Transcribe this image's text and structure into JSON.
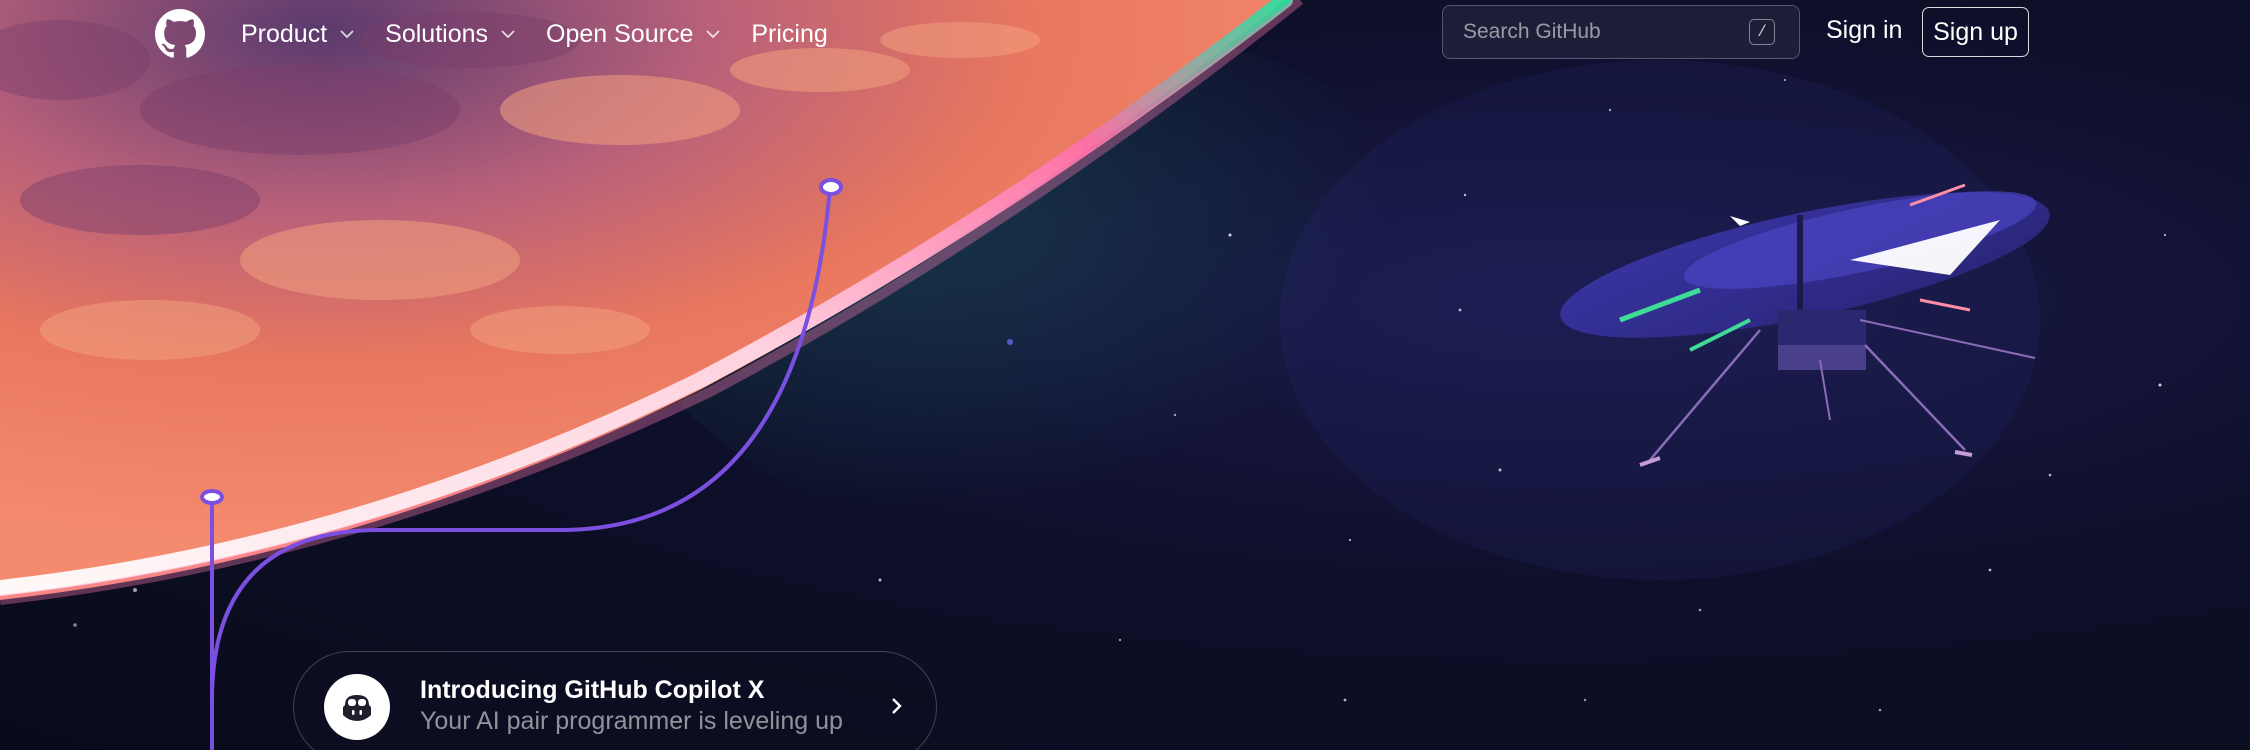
{
  "header": {
    "logo_icon": "github-octocat-icon",
    "nav": [
      {
        "label": "Product",
        "has_dropdown": true
      },
      {
        "label": "Solutions",
        "has_dropdown": true
      },
      {
        "label": "Open Source",
        "has_dropdown": true
      },
      {
        "label": "Pricing",
        "has_dropdown": false
      }
    ],
    "search": {
      "placeholder": "Search GitHub",
      "shortcut": "/"
    },
    "sign_in": "Sign in",
    "sign_up": "Sign up"
  },
  "promo": {
    "icon": "copilot-icon",
    "title": "Introducing GitHub Copilot X",
    "subtitle": "Your AI pair programmer is leveling up"
  },
  "colors": {
    "space": "#0e0f2a",
    "planet": "#e87a62",
    "atmosphere_glow": "#ff9ec0",
    "aurora": "#3ddc97",
    "line": "#7b4fe0",
    "text": "#ffffff"
  }
}
